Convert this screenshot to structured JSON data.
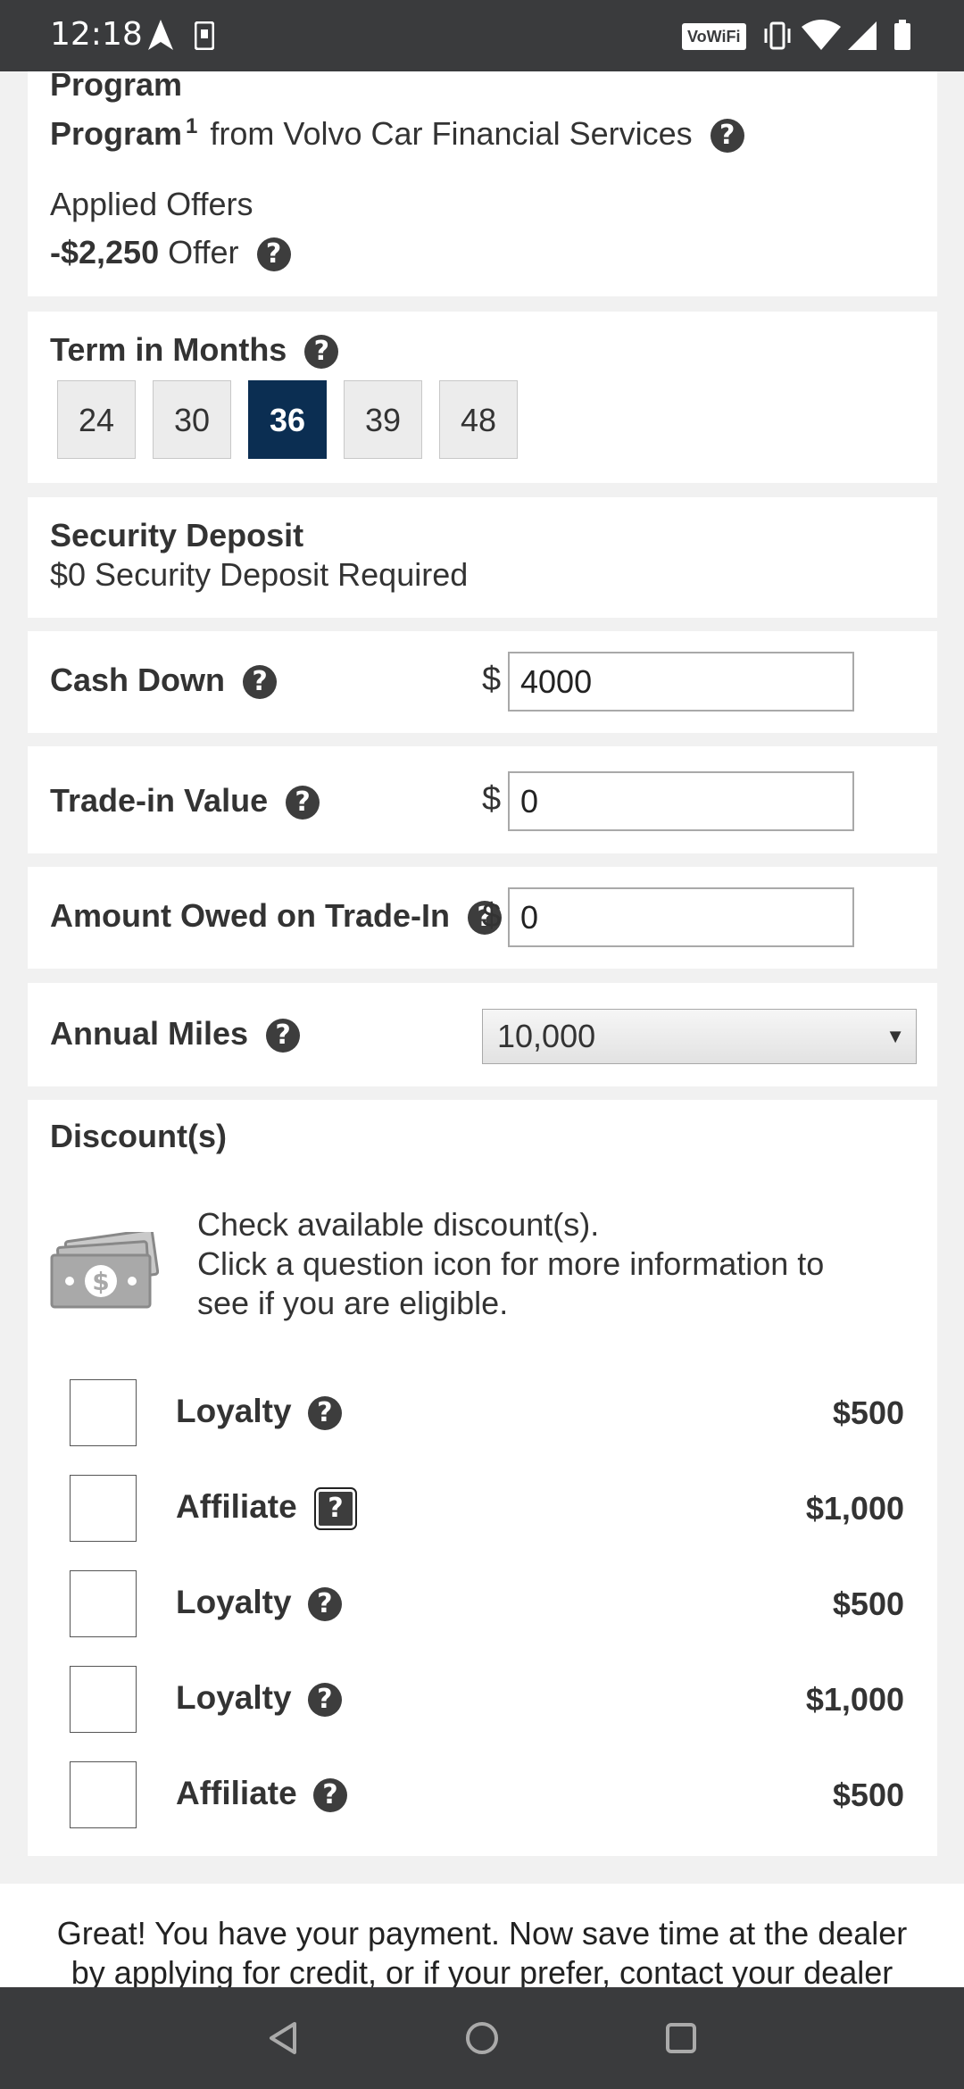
{
  "status_bar": {
    "time": "12:18",
    "wifi_label": "VoWiFi"
  },
  "program": {
    "heading": "Program",
    "program_bold": "Program",
    "superscript": "1",
    "program_from": "from Volvo Car Financial Services",
    "applied_offers_label": "Applied Offers",
    "offer_amount": "-$2,250",
    "offer_word": "Offer"
  },
  "term": {
    "label": "Term in Months",
    "options": [
      "24",
      "30",
      "36",
      "39",
      "48"
    ],
    "selected": "36"
  },
  "security_deposit": {
    "label": "Security Deposit",
    "text": "$0 Security Deposit Required"
  },
  "cash_down": {
    "label": "Cash Down",
    "currency": "$",
    "value": "4000"
  },
  "trade_in": {
    "label": "Trade-in Value",
    "currency": "$",
    "value": "0"
  },
  "amount_owed": {
    "label": "Amount Owed on Trade-In",
    "currency": "$",
    "value": "0"
  },
  "annual_miles": {
    "label": "Annual Miles",
    "selected": "10,000"
  },
  "discounts": {
    "heading": "Discount(s)",
    "intro_line1": "Check available discount(s).",
    "intro_line2": "Click a question icon for more information to",
    "intro_line3": "see if you are eligible.",
    "items": [
      {
        "name": "Loyalty",
        "amount": "$500"
      },
      {
        "name": "Affiliate",
        "amount": "$1,000"
      },
      {
        "name": "Loyalty",
        "amount": "$500"
      },
      {
        "name": "Loyalty",
        "amount": "$1,000"
      },
      {
        "name": "Affiliate",
        "amount": "$500"
      }
    ]
  },
  "footer": {
    "line1": "Great! You have your payment. Now save time at the dealer",
    "line2": "by applying for credit, or if your prefer, contact your dealer"
  },
  "icons": {
    "help": "question-circle-icon",
    "money": "cash-bills-icon",
    "back": "nav-back-icon",
    "home": "nav-home-icon",
    "recents": "nav-recents-icon"
  },
  "colors": {
    "selected_term": "#0b2e52",
    "status_bar": "#3a3b3d"
  }
}
